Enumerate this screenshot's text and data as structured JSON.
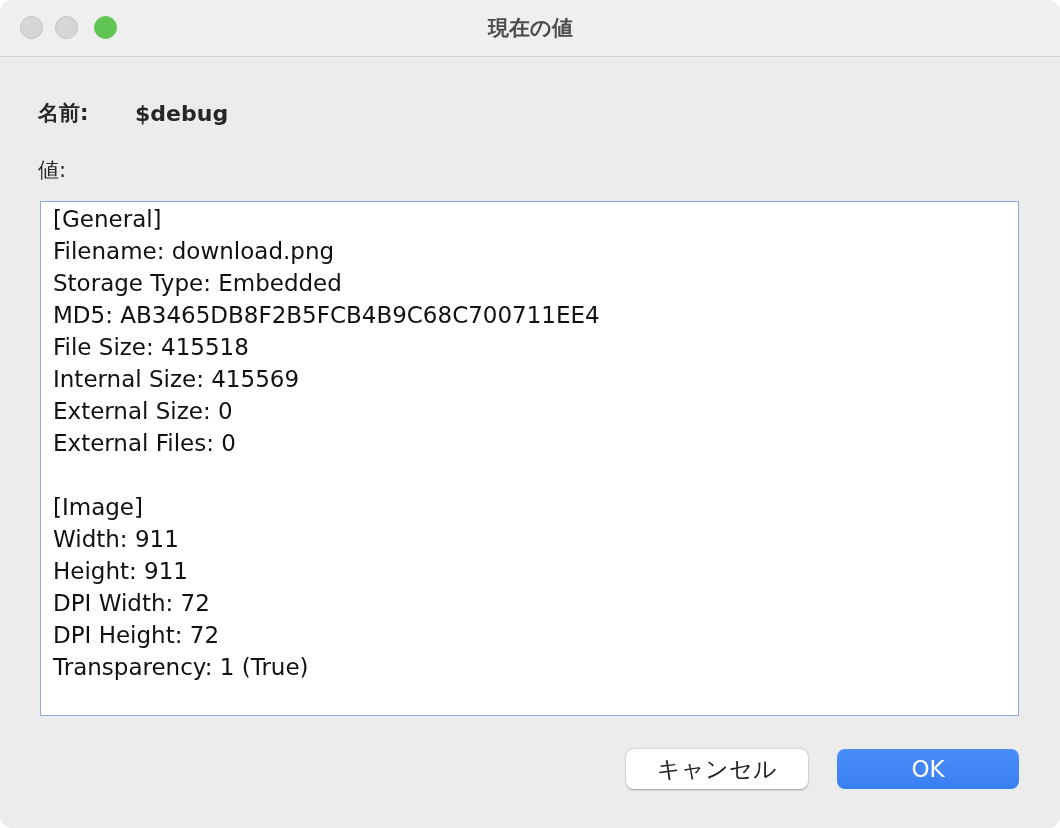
{
  "window": {
    "title": "現在の値",
    "buttons": [
      {
        "kind": "close",
        "enabled": false
      },
      {
        "kind": "minimize",
        "enabled": false
      },
      {
        "kind": "zoom",
        "enabled": true
      }
    ]
  },
  "name": {
    "label": "名前:",
    "value": "$debug"
  },
  "value": {
    "label": "値:",
    "sections": [
      {
        "lines": [
          "[General]",
          "Filename: download.png",
          "Storage Type: Embedded",
          "MD5: AB3465DB8F2B5FCB4B9C68C700711EE4",
          "File Size: 415518",
          "Internal Size: 415569",
          "External Size: 0",
          "External Files: 0"
        ]
      },
      {
        "lines": [
          "[Image]",
          "Width: 911",
          "Height: 911",
          "DPI Width: 72",
          "DPI Height: 72",
          "Transparency: 1 (True)"
        ]
      }
    ]
  },
  "buttons": [
    {
      "label": "キャンセル",
      "kind": "secondary"
    },
    {
      "label": "OK",
      "kind": "default"
    }
  ]
}
